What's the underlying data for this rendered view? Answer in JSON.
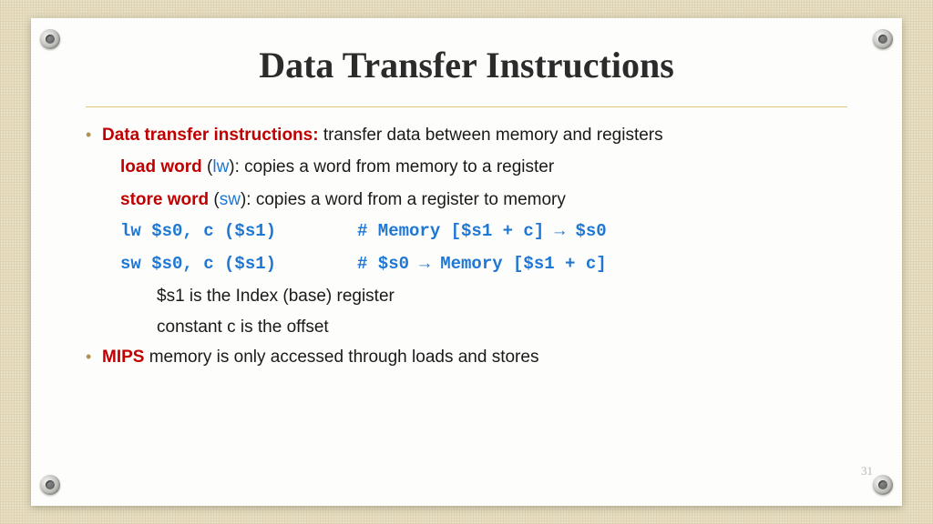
{
  "slide": {
    "title": "Data Transfer Instructions",
    "pageNumber": "31",
    "bullet1": {
      "strong": "Data transfer instructions:",
      "rest": " transfer data between memory and registers"
    },
    "loadword": {
      "label": "load word",
      "paren_open": " (",
      "mnemonic": "lw",
      "paren_close": "): copies a word from memory to a register"
    },
    "storeword": {
      "label": "store word",
      "paren_open": " (",
      "mnemonic": "sw",
      "paren_close": "): copies a word from a register to memory"
    },
    "code1": {
      "instr": "lw $s0, c ($s1)",
      "comment": "# Memory [$s1 + c] → $s0"
    },
    "code2": {
      "instr": "sw $s0, c ($s1)",
      "comment": "# $s0 → Memory [$s1 + c]"
    },
    "note1": "$s1 is the Index (base) register",
    "note2": "constant c is the offset",
    "bullet2": {
      "strong": "MIPS",
      "rest": " memory is only accessed through loads and stores"
    }
  }
}
